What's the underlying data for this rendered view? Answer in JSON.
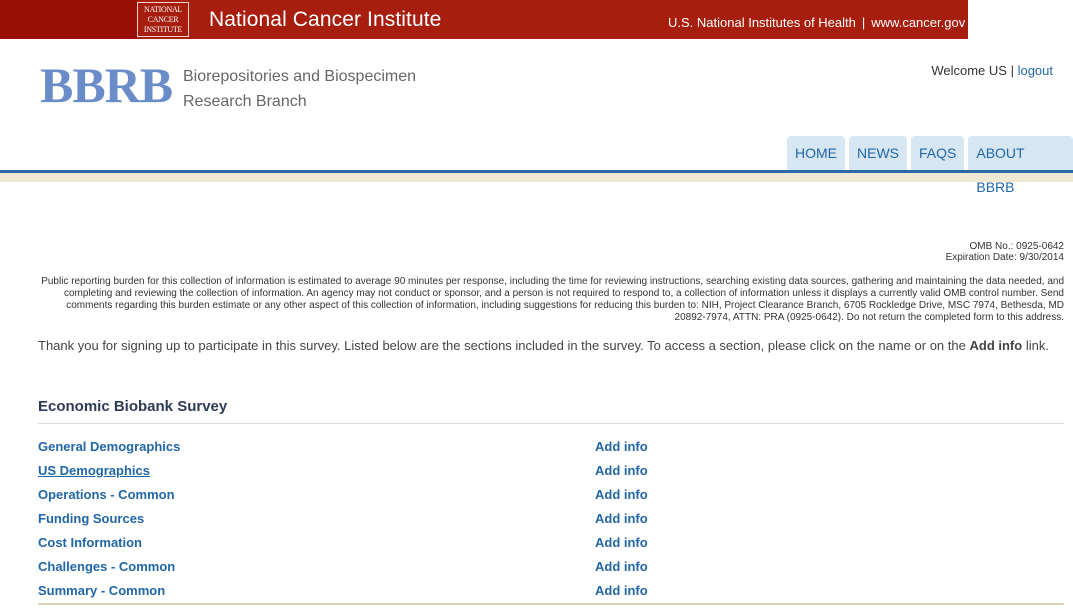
{
  "banner": {
    "logo_lines": [
      "NATIONAL",
      "CANCER",
      "INSTITUTE"
    ],
    "title": "National Cancer Institute",
    "nih_link": "U.S. National Institutes of Health",
    "separator": "|",
    "cancer_gov_link": "www.cancer.gov"
  },
  "header": {
    "logo": "BBRB",
    "subtitle_line1": "Biorepositories and Biospecimen",
    "subtitle_line2": "Research Branch",
    "welcome": "Welcome US",
    "welcome_sep": "|",
    "logout": "logout"
  },
  "nav": {
    "tabs": [
      {
        "label": "HOME"
      },
      {
        "label": "NEWS"
      },
      {
        "label": "FAQS"
      },
      {
        "label": "ABOUT BBRB"
      }
    ]
  },
  "omb": {
    "number": "OMB No.: 0925-0642",
    "expiration": "Expiration Date: 9/30/2014"
  },
  "burden_statement": "Public reporting burden for this collection of information is estimated to average 90 minutes per response, including the time for reviewing instructions, searching existing data sources, gathering and maintaining the data needed, and completing and reviewing the collection of information. An agency may not conduct or sponsor, and a person is not required to respond to, a collection of information unless it displays a currently valid OMB control number. Send comments regarding this burden estimate or any other aspect of this collection of information, including suggestions for reducing this burden to: NIH, Project Clearance Branch, 6705 Rockledge Drive, MSC 7974, Bethesda, MD 20892-7974, ATTN: PRA (0925-0642). Do not return the completed form to this address.",
  "intro": {
    "text": "Thank you for signing up to participate in this survey. Listed below are the sections included in the survey. To access a section, please click on the name or on the",
    "bold": "Add info",
    "tail": "link."
  },
  "survey": {
    "title": "Economic Biobank Survey",
    "sections": [
      {
        "name": "General Demographics",
        "action": "Add info"
      },
      {
        "name": "US Demographics",
        "action": "Add info"
      },
      {
        "name": "Operations - Common",
        "action": "Add info"
      },
      {
        "name": "Funding Sources",
        "action": "Add info"
      },
      {
        "name": "Cost Information",
        "action": "Add info"
      },
      {
        "name": "Challenges - Common",
        "action": "Add info"
      },
      {
        "name": "Summary - Common",
        "action": "Add info"
      }
    ]
  }
}
